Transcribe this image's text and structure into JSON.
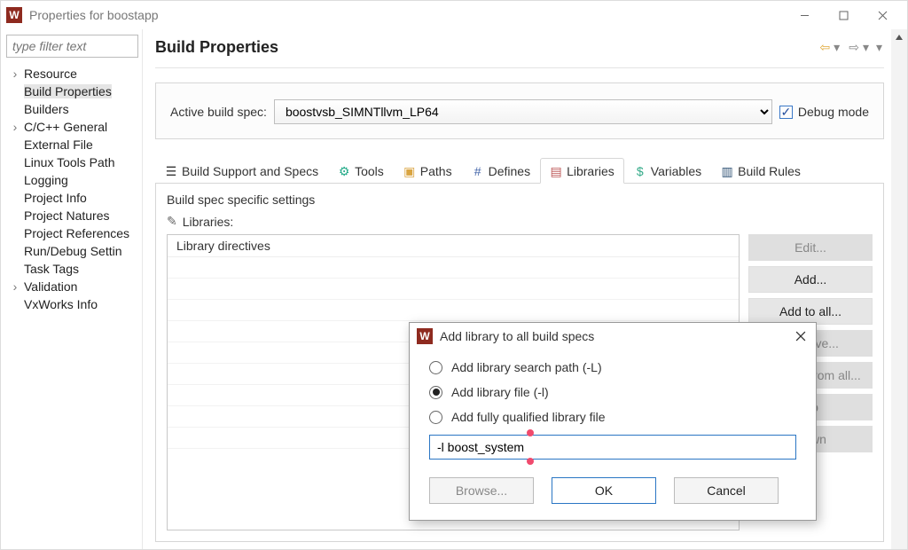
{
  "window": {
    "title": "Properties for boostapp"
  },
  "sidebar": {
    "filter_placeholder": "type filter text",
    "items": [
      {
        "label": "Resource",
        "chevron": true,
        "child": false
      },
      {
        "label": "Build Properties",
        "chevron": false,
        "child": true,
        "selected": true
      },
      {
        "label": "Builders",
        "chevron": false,
        "child": true
      },
      {
        "label": "C/C++ General",
        "chevron": true,
        "child": false
      },
      {
        "label": "External File",
        "chevron": false,
        "child": true
      },
      {
        "label": "Linux Tools Path",
        "chevron": false,
        "child": true
      },
      {
        "label": "Logging",
        "chevron": false,
        "child": true
      },
      {
        "label": "Project Info",
        "chevron": false,
        "child": true
      },
      {
        "label": "Project Natures",
        "chevron": false,
        "child": true
      },
      {
        "label": "Project References",
        "chevron": false,
        "child": true
      },
      {
        "label": "Run/Debug Settin",
        "chevron": false,
        "child": true
      },
      {
        "label": "Task Tags",
        "chevron": false,
        "child": true
      },
      {
        "label": "Validation",
        "chevron": true,
        "child": false
      },
      {
        "label": "VxWorks Info",
        "chevron": false,
        "child": true
      }
    ]
  },
  "header": {
    "title": "Build Properties"
  },
  "spec": {
    "label": "Active build spec:",
    "value": "boostvsb_SIMNTllvm_LP64",
    "debug_label": "Debug mode",
    "debug_checked": true
  },
  "tabs": [
    {
      "label": "Build Support and Specs",
      "icon": "gear-group-icon"
    },
    {
      "label": "Tools",
      "icon": "plug-icon"
    },
    {
      "label": "Paths",
      "icon": "folder-icon"
    },
    {
      "label": "Defines",
      "icon": "hash-icon"
    },
    {
      "label": "Libraries",
      "icon": "book-icon",
      "active": true
    },
    {
      "label": "Variables",
      "icon": "dollar-icon"
    },
    {
      "label": "Build Rules",
      "icon": "bars-icon"
    }
  ],
  "section": {
    "settings_title": "Build spec specific settings",
    "libraries_label": "Libraries:",
    "list_header": "Library directives"
  },
  "buttons": {
    "edit": "Edit...",
    "add": "Add...",
    "add_all": "Add to all...",
    "remove": "Remove...",
    "remove_all": "Remove from all...",
    "up": "Up",
    "down": "Down"
  },
  "dialog": {
    "title": "Add library to all build specs",
    "options": [
      {
        "label": "Add library search path (-L)"
      },
      {
        "label": "Add library file (-l)",
        "selected": true
      },
      {
        "label": "Add fully qualified library file"
      }
    ],
    "value": "-l boost_system",
    "browse": "Browse...",
    "ok": "OK",
    "cancel": "Cancel"
  }
}
